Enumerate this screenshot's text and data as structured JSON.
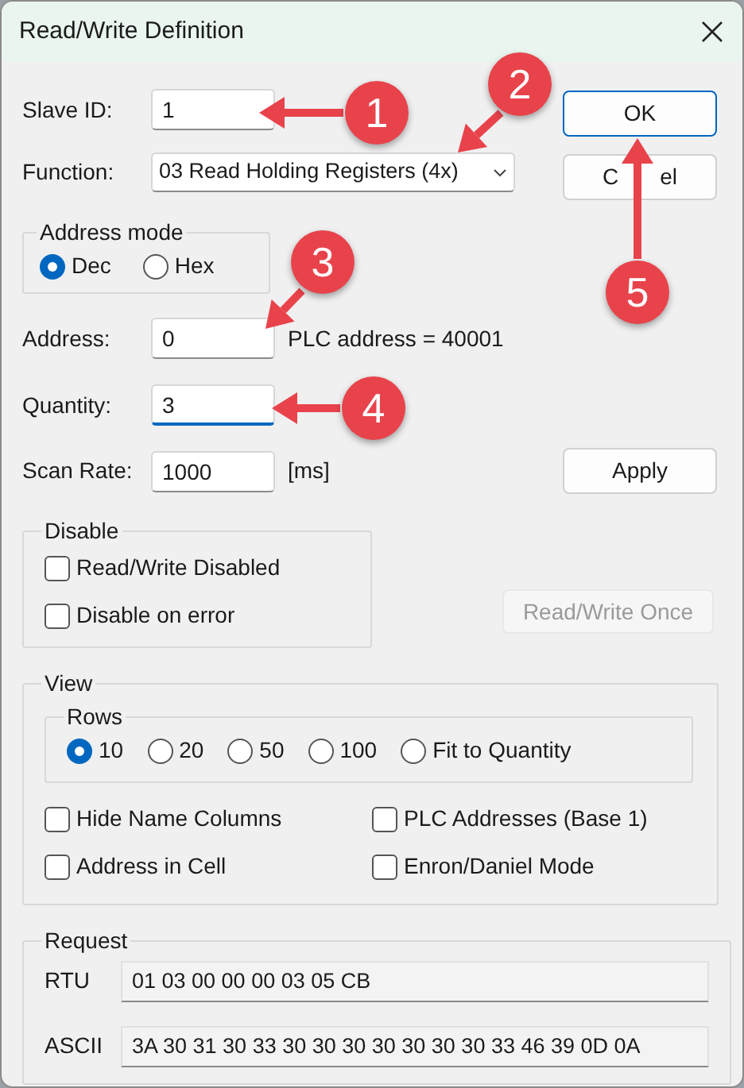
{
  "window": {
    "title": "Read/Write Definition"
  },
  "slave_id": {
    "label": "Slave ID:",
    "value": "1"
  },
  "function": {
    "label": "Function:",
    "value": "03 Read Holding Registers (4x)"
  },
  "ok_button": {
    "label": "OK",
    "default": true
  },
  "cancel_button": {
    "label_parts": [
      "C",
      "el"
    ]
  },
  "address_mode": {
    "title": "Address mode",
    "options": [
      {
        "label": "Dec",
        "selected": true
      },
      {
        "label": "Hex",
        "selected": false
      }
    ]
  },
  "address": {
    "label": "Address:",
    "value": "0",
    "note": "PLC address = 40001"
  },
  "quantity": {
    "label": "Quantity:",
    "value": "3",
    "focused": true
  },
  "scan_rate": {
    "label": "Scan Rate:",
    "value": "1000",
    "unit": "[ms]"
  },
  "apply_button": {
    "label": "Apply"
  },
  "disable": {
    "title": "Disable",
    "options": [
      {
        "label": "Read/Write Disabled",
        "checked": false
      },
      {
        "label": "Disable on error",
        "checked": false
      }
    ]
  },
  "read_write_once": {
    "label": "Read/Write Once",
    "disabled": true
  },
  "view": {
    "title": "View",
    "rows": {
      "title": "Rows",
      "options": [
        {
          "label": "10",
          "selected": true
        },
        {
          "label": "20",
          "selected": false
        },
        {
          "label": "50",
          "selected": false
        },
        {
          "label": "100",
          "selected": false
        },
        {
          "label": "Fit to Quantity",
          "selected": false
        }
      ]
    },
    "options": [
      {
        "label": "Hide Name Columns",
        "checked": false
      },
      {
        "label": "PLC Addresses (Base 1)",
        "checked": false
      },
      {
        "label": "Address in Cell",
        "checked": false
      },
      {
        "label": "Enron/Daniel Mode",
        "checked": false
      }
    ]
  },
  "request": {
    "title": "Request",
    "rows": [
      {
        "label": "RTU",
        "value": "01 03 00 00 00 03 05 CB"
      },
      {
        "label": "ASCII",
        "value": "3A 30 31 30 33 30 30 30 30 30 30 30 33 46 39 0D 0A"
      }
    ]
  },
  "annotations": [
    {
      "label": "1"
    },
    {
      "label": "2"
    },
    {
      "label": "3"
    },
    {
      "label": "4"
    },
    {
      "label": "5"
    }
  ]
}
